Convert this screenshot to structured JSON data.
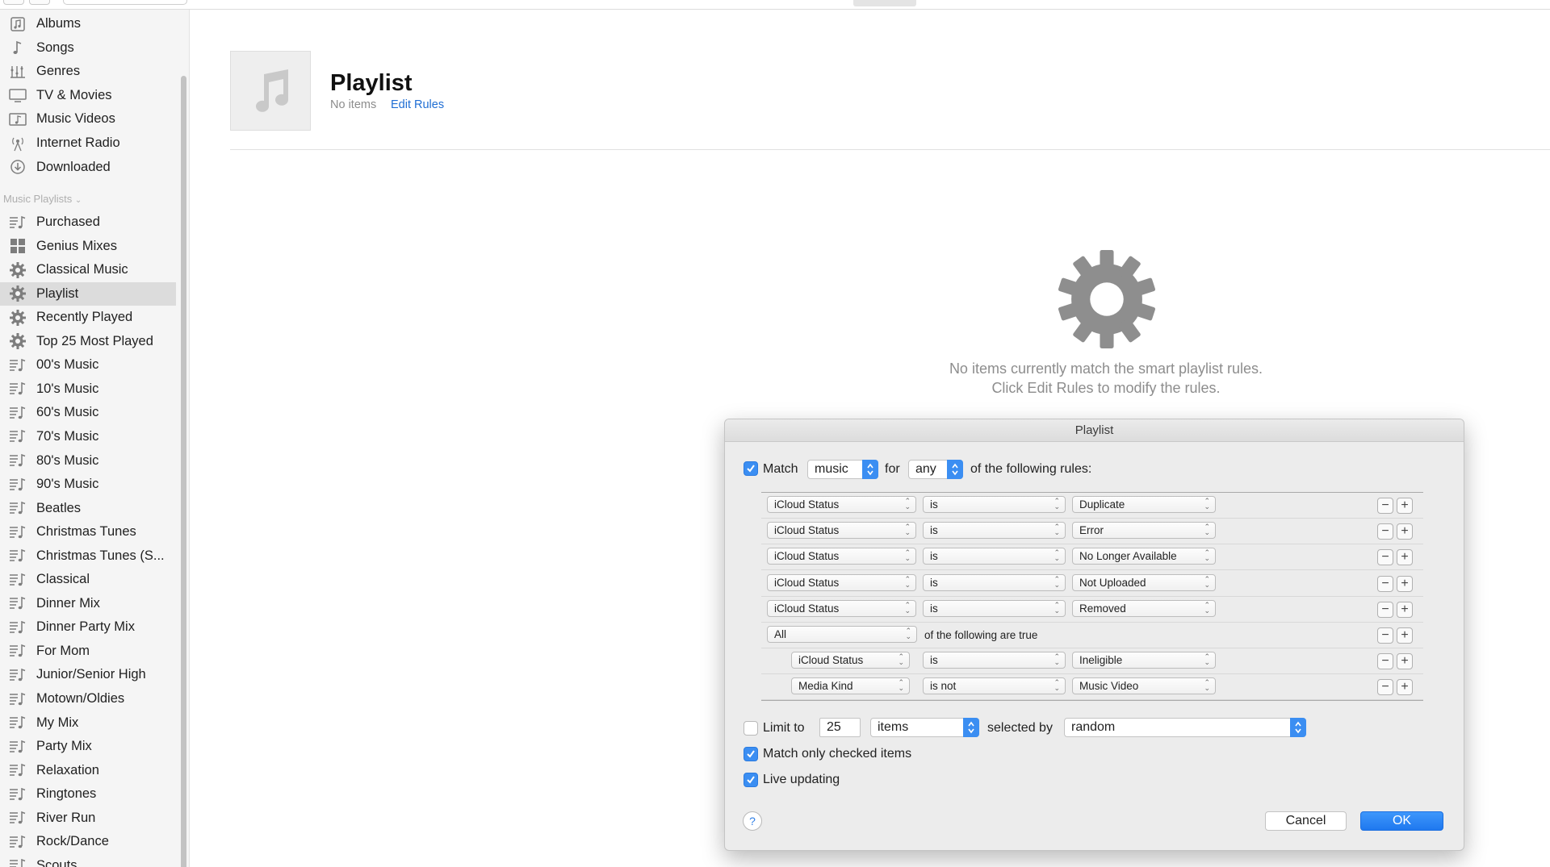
{
  "sidebar": {
    "library_items": [
      {
        "label": "Albums",
        "icon": "albums-icon"
      },
      {
        "label": "Songs",
        "icon": "note-icon"
      },
      {
        "label": "Genres",
        "icon": "genres-icon"
      },
      {
        "label": "TV & Movies",
        "icon": "tv-icon"
      },
      {
        "label": "Music Videos",
        "icon": "music-video-icon"
      },
      {
        "label": "Internet Radio",
        "icon": "radio-icon"
      },
      {
        "label": "Downloaded",
        "icon": "download-icon"
      }
    ],
    "section_label": "Music Playlists",
    "playlists": [
      {
        "label": "Purchased",
        "icon": "playlist-icon"
      },
      {
        "label": "Genius Mixes",
        "icon": "genius-icon"
      },
      {
        "label": "Classical Music",
        "icon": "gear-icon"
      },
      {
        "label": "Playlist",
        "icon": "gear-icon",
        "active": true
      },
      {
        "label": "Recently Played",
        "icon": "gear-icon"
      },
      {
        "label": "Top 25 Most Played",
        "icon": "gear-icon"
      },
      {
        "label": "00's Music",
        "icon": "playlist-icon"
      },
      {
        "label": "10's Music",
        "icon": "playlist-icon"
      },
      {
        "label": "60's Music",
        "icon": "playlist-icon"
      },
      {
        "label": "70's Music",
        "icon": "playlist-icon"
      },
      {
        "label": "80's Music",
        "icon": "playlist-icon"
      },
      {
        "label": "90's Music",
        "icon": "playlist-icon"
      },
      {
        "label": "Beatles",
        "icon": "playlist-icon"
      },
      {
        "label": "Christmas Tunes",
        "icon": "playlist-icon"
      },
      {
        "label": "Christmas Tunes (S...",
        "icon": "playlist-icon"
      },
      {
        "label": "Classical",
        "icon": "playlist-icon"
      },
      {
        "label": "Dinner Mix",
        "icon": "playlist-icon"
      },
      {
        "label": "Dinner Party Mix",
        "icon": "playlist-icon"
      },
      {
        "label": "For Mom",
        "icon": "playlist-icon"
      },
      {
        "label": "Junior/Senior High",
        "icon": "playlist-icon"
      },
      {
        "label": "Motown/Oldies",
        "icon": "playlist-icon"
      },
      {
        "label": "My Mix",
        "icon": "playlist-icon"
      },
      {
        "label": "Party Mix",
        "icon": "playlist-icon"
      },
      {
        "label": "Relaxation",
        "icon": "playlist-icon"
      },
      {
        "label": "Ringtones",
        "icon": "playlist-icon"
      },
      {
        "label": "River Run",
        "icon": "playlist-icon"
      },
      {
        "label": "Rock/Dance",
        "icon": "playlist-icon"
      },
      {
        "label": "Scouts",
        "icon": "playlist-icon"
      }
    ]
  },
  "header": {
    "title": "Playlist",
    "count": "No items",
    "edit_rules": "Edit Rules"
  },
  "empty_state": {
    "line1": "No items currently match the smart playlist rules.",
    "line2": "Click Edit Rules to modify the rules."
  },
  "dialog": {
    "title": "Playlist",
    "match_checked": true,
    "match_label": "Match",
    "match_kind": "music",
    "for_label": "for",
    "match_mode": "any",
    "rules_suffix": "of the following rules:",
    "rules": [
      {
        "field": "iCloud Status",
        "op": "is",
        "value": "Duplicate"
      },
      {
        "field": "iCloud Status",
        "op": "is",
        "value": "Error"
      },
      {
        "field": "iCloud Status",
        "op": "is",
        "value": "No Longer Available"
      },
      {
        "field": "iCloud Status",
        "op": "is",
        "value": "Not Uploaded"
      },
      {
        "field": "iCloud Status",
        "op": "is",
        "value": "Removed"
      },
      {
        "group": "All",
        "text": "of the following are true"
      },
      {
        "field": "iCloud Status",
        "op": "is",
        "value": "Ineligible",
        "nested": true
      },
      {
        "field": "Media Kind",
        "op": "is not",
        "value": "Music Video",
        "nested": true
      }
    ],
    "limit_checked": false,
    "limit_label": "Limit to",
    "limit_value": "25",
    "limit_unit": "items",
    "selected_by_label": "selected by",
    "selected_by": "random",
    "match_checked_items": true,
    "match_checked_items_label": "Match only checked items",
    "live_updating": true,
    "live_updating_label": "Live updating",
    "help": "?",
    "cancel": "Cancel",
    "ok": "OK"
  },
  "colors": {
    "accent": "#3b8ef2",
    "link": "#1f6ed4",
    "sidebar_bg": "#f5f5f5",
    "sidebar_active": "#dcdcdc"
  }
}
